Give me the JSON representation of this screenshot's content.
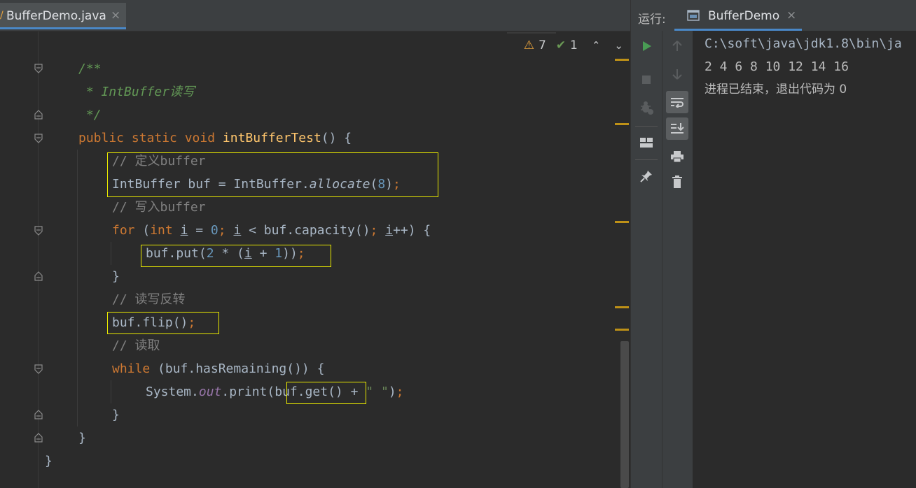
{
  "editor": {
    "tab_title": "BufferDemo.java",
    "tab_close": "×",
    "inspections": {
      "warnings": "7",
      "checks": "1"
    }
  },
  "code": {
    "doc_open": "/**",
    "doc_body": " * IntBuffer读写",
    "doc_close": " */",
    "sig_public": "public ",
    "sig_static": "static ",
    "sig_void": "void ",
    "sig_name": "intBufferTest",
    "sig_rest": "() {",
    "c1": "// 定义buffer",
    "l2_a": "IntBuffer buf = IntBuffer.",
    "l2_b": "allocate",
    "l2_c": "(",
    "l2_num": "8",
    "l2_d": ")",
    "l2_semi": ";",
    "c2": "// 写入buffer",
    "for_kw": "for",
    "for_a": " (",
    "for_int": "int",
    "for_sp": " ",
    "for_i1": "i",
    "for_eq": " = ",
    "for_zero": "0",
    "for_semi1": ";",
    "for_sp2": " ",
    "for_i2": "i",
    "for_cap": " < buf.capacity()",
    "for_semi2": ";",
    "for_sp3": " ",
    "for_i3": "i",
    "for_end": "++) {",
    "put_a": "buf.put(",
    "put_two": "2",
    "put_b": " * (",
    "put_i": "i",
    "put_c": " + ",
    "put_one": "1",
    "put_d": "))",
    "put_semi": ";",
    "close_brace": "}",
    "c3": "// 读写反转",
    "flip": "buf.flip()",
    "flip_semi": ";",
    "c4": "// 读取",
    "while_kw": "while",
    "while_rest": " (buf.hasRemaining()) {",
    "print_a": "System.",
    "print_out": "out",
    "print_b": ".print(",
    "print_get": "buf.get()",
    "print_c": " + ",
    "print_str": "\" \"",
    "print_d": ")",
    "print_semi": ";"
  },
  "run": {
    "label": "运行:",
    "tab_title": "BufferDemo",
    "tab_close": "×",
    "console": [
      "C:\\soft\\java\\jdk1.8\\bin\\ja",
      "2 4 6 8 10 12 14 16",
      "进程已结束，退出代码为 0"
    ]
  },
  "colors": {
    "accent_tab": "#4a88c7",
    "highlight_box": "#e8e800",
    "run_green": "#499c54"
  }
}
